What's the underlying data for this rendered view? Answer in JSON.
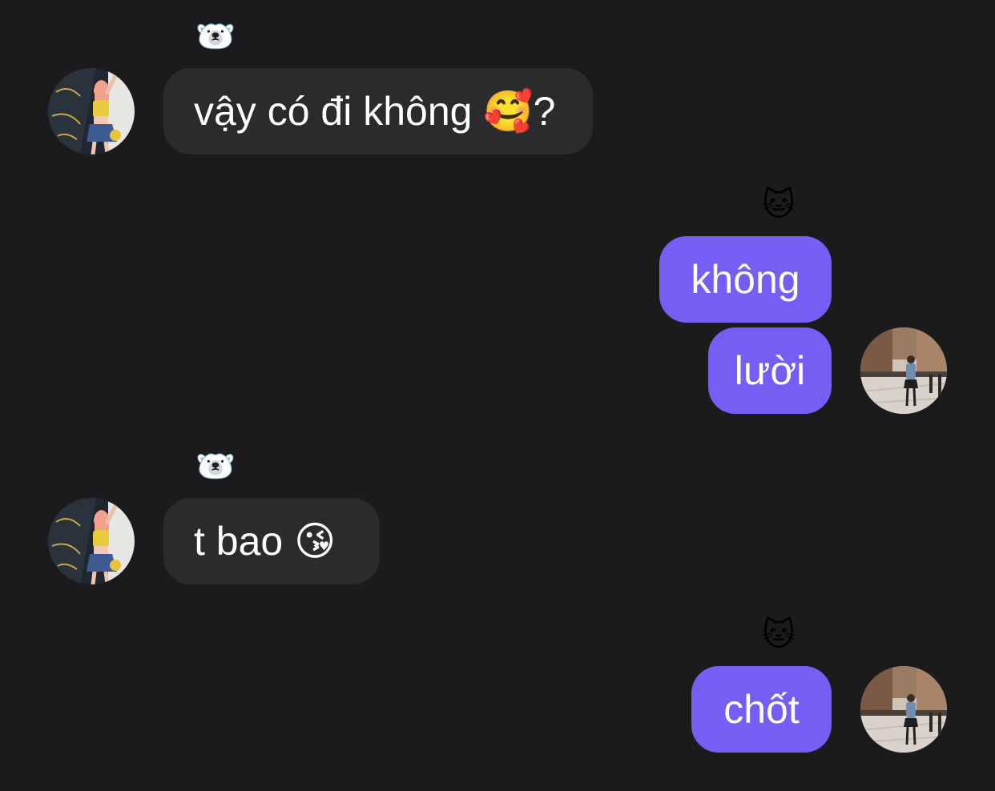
{
  "messages": [
    {
      "side": "incoming",
      "reaction": "🐻‍❄️",
      "text": "vậy có đi không ",
      "emoji": "🥰",
      "suffix": "?"
    },
    {
      "side": "outgoing",
      "reaction": "🐱",
      "text": "không"
    },
    {
      "side": "outgoing",
      "text": "lười"
    },
    {
      "side": "incoming",
      "reaction": "🐻‍❄️",
      "text": "t bao ",
      "emoji": "😘"
    },
    {
      "side": "outgoing",
      "reaction": "🐱",
      "text": "chốt"
    }
  ],
  "avatars": {
    "contact": "photo of person in yellow top and blue skirt",
    "me": "photo of person on a city street"
  },
  "colors": {
    "background": "#1b1b1d",
    "incoming_bubble": "#2b2b2e",
    "outgoing_bubble": "#775df3",
    "text": "#ffffff"
  }
}
